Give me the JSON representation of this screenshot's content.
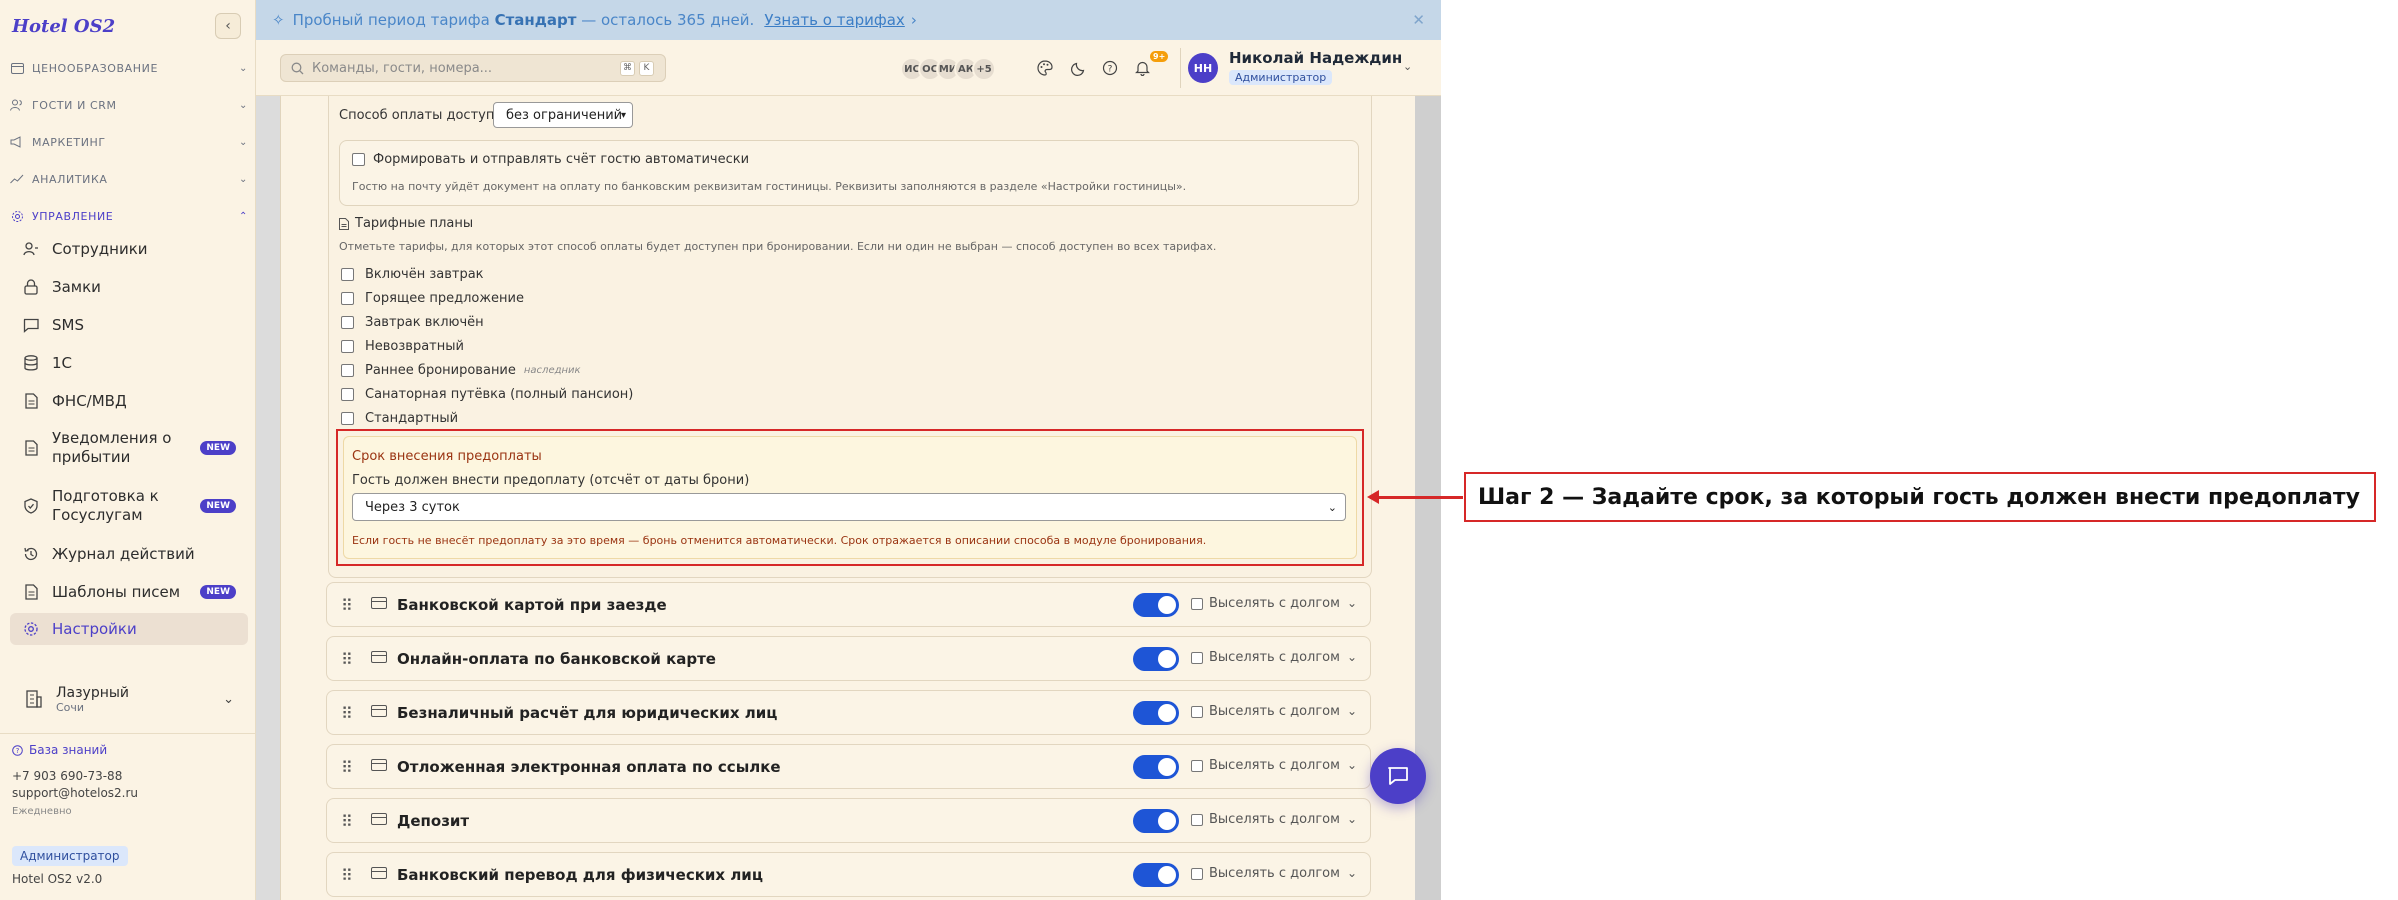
{
  "sidebar": {
    "brand": "Hotel OS2",
    "groups": [
      {
        "label": "ЦЕНООБРАЗОВАНИЕ"
      },
      {
        "label": "ГОСТИ И CRM"
      },
      {
        "label": "МАРКЕТИНГ"
      },
      {
        "label": "АНАЛИТИКА"
      },
      {
        "label": "УПРАВЛЕНИЕ"
      }
    ],
    "items": [
      {
        "label": "Сотрудники"
      },
      {
        "label": "Замки"
      },
      {
        "label": "SMS"
      },
      {
        "label": "1С"
      },
      {
        "label": "ФНС/МВД"
      },
      {
        "label": "Уведомления о прибытии",
        "badge": "NEW"
      },
      {
        "label": "Подготовка к Госуслугам",
        "badge": "NEW"
      },
      {
        "label": "Журнал действий"
      },
      {
        "label": "Шаблоны писем",
        "badge": "NEW"
      },
      {
        "label": "Настройки"
      }
    ],
    "hotel": {
      "name": "Лазурный",
      "city": "Сочи"
    },
    "knowledge_base": "База знаний",
    "phone": "+7 903 690-73-88",
    "email": "support@hotelos2.ru",
    "hours": "Ежедневно",
    "role": "Администратор",
    "version": "Hotel OS2 v2.0"
  },
  "banner": {
    "prefix": "Пробный период тарифа",
    "plan": "Стандарт",
    "suffix": "— осталось 365 дней.",
    "link": "Узнать о тарифах",
    "link_arrow": "›",
    "close": "✕"
  },
  "header": {
    "search_placeholder": "Команды, гости, номера...",
    "kbd1": "⌘",
    "kbd2": "K",
    "avatars": [
      "ИС",
      "ОС",
      "МИ",
      "АК",
      "+5"
    ],
    "bell_badge": "9+",
    "user_initials": "НН",
    "user_name": "Николай Надеждин",
    "user_role": "Администратор"
  },
  "form": {
    "payment_available_label": "Способ оплаты доступен",
    "payment_available_value": "без ограничений",
    "auto_invoice_label": "Формировать и отправлять счёт гостю автоматически",
    "auto_invoice_hint": "Гостю на почту уйдёт документ на оплату по банковским реквизитам гостиницы. Реквизиты заполняются в разделе «Настройки гостиницы».",
    "tariffs_title": "Тарифные планы",
    "tariffs_hint": "Отметьте тарифы, для которых этот способ оплаты будет доступен при бронировании. Если ни один не выбран — способ доступен во всех тарифах.",
    "tariffs": [
      {
        "label": "Включён завтрак",
        "tag": ""
      },
      {
        "label": "Горящее предложение",
        "tag": ""
      },
      {
        "label": "Завтрак включён",
        "tag": ""
      },
      {
        "label": "Невозвратный",
        "tag": ""
      },
      {
        "label": "Раннее бронирование",
        "tag": "наследник"
      },
      {
        "label": "Санаторная путёвка (полный пансион)",
        "tag": ""
      },
      {
        "label": "Стандартный",
        "tag": ""
      }
    ],
    "prepay": {
      "title": "Срок внесения предоплаты",
      "label": "Гость должен внести предоплату (отсчёт от даты брони)",
      "value": "Через 3 суток",
      "note": "Если гость не внесёт предоплату за это время — бронь отменится автоматически. Срок отражается в описании способа в модуле бронирования."
    }
  },
  "payment_methods": [
    {
      "name": "Банковской картой при заезде",
      "evict_label": "Выселять с долгом",
      "enabled": true
    },
    {
      "name": "Онлайн-оплата по банковской карте",
      "evict_label": "Выселять с долгом",
      "enabled": true
    },
    {
      "name": "Безналичный расчёт для юридических лиц",
      "evict_label": "Выселять с долгом",
      "enabled": true
    },
    {
      "name": "Отложенная электронная оплата по ссылке",
      "evict_label": "Выселять с долгом",
      "enabled": true
    },
    {
      "name": "Депозит",
      "evict_label": "Выселять с долгом",
      "enabled": true
    },
    {
      "name": "Банковский перевод для физических лиц",
      "evict_label": "Выселять с долгом",
      "enabled": true
    }
  ],
  "annotation": {
    "text": "Шаг 2 — Задайте срок, за который гость должен внести предоплату",
    "color": "#d62828"
  },
  "colors": {
    "accent": "#4c3fc8",
    "toggle_on": "#1e55d6",
    "banner_bg": "#c5d7e8",
    "sidebar_bg": "#fbf3e4"
  }
}
